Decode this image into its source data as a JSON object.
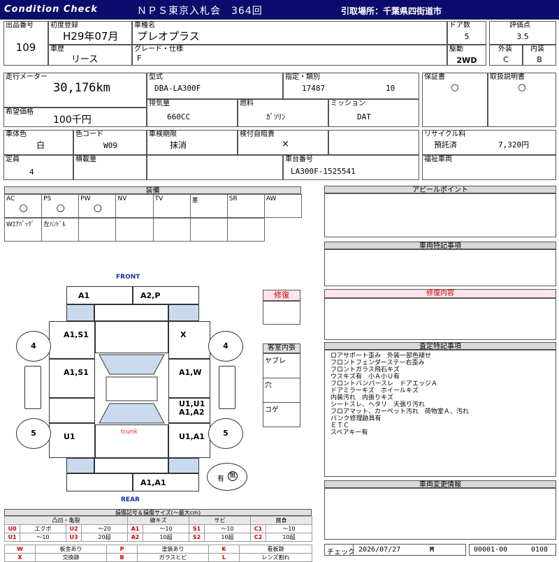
{
  "header": {
    "brand": "Condition Check",
    "auction": "ＮＰＳ東京入札会　364回",
    "pickup": "引取場所：千葉県四街道市"
  },
  "row1": {
    "lot_label": "出品番号",
    "lot_value": "109",
    "reg_label": "初度登録",
    "reg_value": "H29年07月",
    "history_label": "車歴",
    "history_value": "リース",
    "model_label": "車種名",
    "model_value": "プレオプラス",
    "grade_label": "グレード・仕様",
    "grade_value": "F",
    "doors_label": "ドア数",
    "doors_value": "5",
    "drive_label": "駆動",
    "drive_value": "2WD",
    "score_label": "評価点",
    "score_value": "3.5",
    "ext_label": "外装",
    "ext_value": "C",
    "int_label": "内装",
    "int_value": "B"
  },
  "row2": {
    "mileage_label": "走行メーター",
    "mileage_value": "30,176km",
    "price_label": "希望価格",
    "price_value": "100千円",
    "type_label": "型式",
    "type_value": "DBA-LA300F",
    "spec_label": "指定・類別",
    "spec_value1": "17487",
    "spec_value2": "10",
    "warranty_label": "保証書",
    "warranty_value": "○",
    "manual_label": "取扱説明書",
    "manual_value": "○",
    "disp_label": "排気量",
    "disp_value": "660CC",
    "fuel_label": "燃料",
    "fuel_value": "ｶﾞｿﾘﾝ",
    "mission_label": "ミッション",
    "mission_value": "DAT"
  },
  "row3": {
    "color_label": "車体色",
    "color_value": "白",
    "code_label": "色コード",
    "code_value": "W09",
    "inspect_label": "車検期限",
    "inspect_value": "抹消",
    "insure_label": "検付自賠責",
    "insure_value": "×",
    "recycle_label": "リサイクル料",
    "recycle_status": "預託済",
    "recycle_amount": "7,320円",
    "capacity_label": "定員",
    "capacity_value": "4",
    "load_label": "積載量",
    "load_value": "",
    "chassis_label": "車台番号",
    "chassis_value": "LA300F-1525541",
    "welfare_label": "福祉車両",
    "welfare_value": ""
  },
  "equipment": {
    "title": "装備",
    "row1": [
      {
        "label": "AC",
        "mark": "○"
      },
      {
        "label": "PS",
        "mark": "○"
      },
      {
        "label": "PW",
        "mark": "○"
      },
      {
        "label": "NV",
        "mark": ""
      },
      {
        "label": "TV",
        "mark": ""
      },
      {
        "label": "革",
        "mark": ""
      },
      {
        "label": "SR",
        "mark": ""
      },
      {
        "label": "AW",
        "mark": ""
      }
    ],
    "row2": [
      {
        "label": "Wｴｱﾊﾞｯｸﾞ",
        "mark": ""
      },
      {
        "label": "左ﾊﾝﾄﾞﾙ",
        "mark": ""
      },
      {
        "label": "",
        "mark": ""
      },
      {
        "label": "",
        "mark": ""
      },
      {
        "label": "",
        "mark": ""
      },
      {
        "label": "",
        "mark": ""
      },
      {
        "label": "",
        "mark": ""
      }
    ]
  },
  "diagram": {
    "front": "FRONT",
    "rear": "REAR",
    "trunk": "trunk",
    "tire_fl": "4",
    "tire_fr": "4",
    "tire_rl": "5",
    "tire_rr": "5",
    "front_a": "A1",
    "front_b": "A2,P",
    "left_front": "A1,S1",
    "right_front": "X",
    "left_mid": "A1,S1",
    "right_mid": "A1,W",
    "right_mid2a": "U1,U1",
    "right_mid2b": "A1,A2",
    "left_rear": "U1",
    "right_rear": "U1,A1",
    "rear_bumper": "A1,A1",
    "spare_label": "有",
    "spare_mark": "無"
  },
  "repair": {
    "title": "修復"
  },
  "cabin": {
    "title": "客室内張",
    "items": [
      "ヤブレ",
      "穴",
      "コゲ"
    ]
  },
  "appeal": {
    "title": "アピールポイント"
  },
  "special": {
    "title": "車両特記事項"
  },
  "repair_content": {
    "title": "修復内容"
  },
  "inspection": {
    "title": "査定特記事項",
    "notes": [
      "ロアサポート歪み　外装一部色褪せ",
      "フロントフェンダーステー右歪み",
      "フロントガラス飛石キズ",
      "ウスキズ有　小Ａ小Ｕ有",
      "フロントバンパースレ　ドアエッジＡ",
      "ドアミラーキズ　ホイールキズ",
      "内装汚れ　内張りキズ",
      "シートスレ、ヘタリ　天張り汚れ",
      "フロアマット、カーペット汚れ　荷物室Ａ、汚れ",
      "パンク修理跡具有",
      "ＥＴＣ",
      "スペアキー有"
    ]
  },
  "change": {
    "title": "車両変更情報"
  },
  "check": {
    "label": "チェック",
    "date": "2026/07/27",
    "mark": "M",
    "code1": "00001-00",
    "code2": "0108"
  },
  "legend": {
    "title": "損傷記号＆損傷サイズ(〜最大cm)",
    "headers": [
      "凸凹・亀裂",
      "線キズ",
      "サビ",
      "腐食"
    ],
    "row1": [
      {
        "code": "U0",
        "desc": "エクボ"
      },
      {
        "code": "U2",
        "desc": "〜20"
      },
      {
        "code": "A1",
        "desc": "〜10"
      },
      {
        "code": "S1",
        "desc": "〜10"
      },
      {
        "code": "C1",
        "desc": "〜10"
      }
    ],
    "row2": [
      {
        "code": "U1",
        "desc": "〜10"
      },
      {
        "code": "U3",
        "desc": "20超"
      },
      {
        "code": "A2",
        "desc": "10超"
      },
      {
        "code": "S2",
        "desc": "10超"
      },
      {
        "code": "C2",
        "desc": "10超"
      }
    ],
    "row3": [
      {
        "code": "W",
        "desc": "板金あり"
      },
      {
        "code": "P",
        "desc": "塗装あり"
      },
      {
        "code": "K",
        "desc": "看板跡"
      }
    ],
    "row4": [
      {
        "code": "X",
        "desc": "交換跡"
      },
      {
        "code": "B",
        "desc": "ガラスヒビ"
      },
      {
        "code": "L",
        "desc": "レンズ割れ"
      }
    ]
  },
  "colors": {
    "header_bg": "#0c0c6c",
    "red_code": "#d00000",
    "blue_fill": "#c9daee",
    "front_rear_text": "#1a2ea0",
    "trunk_text": "#e03030"
  }
}
